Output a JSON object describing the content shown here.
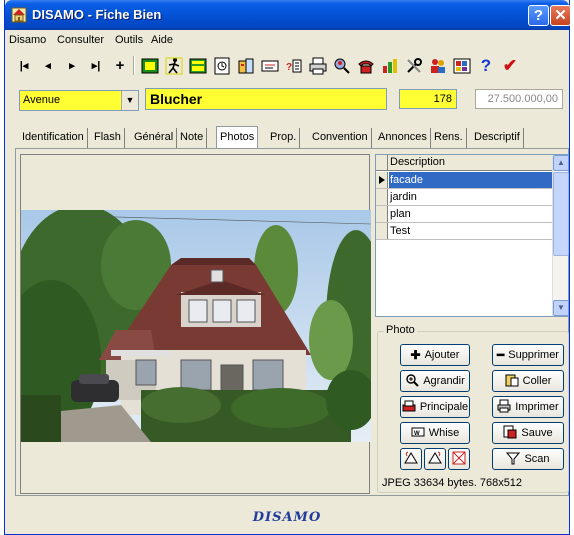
{
  "window": {
    "title": "DISAMO - Fiche Bien",
    "help_label": "?",
    "close_label": "✕"
  },
  "menu": [
    "Disamo",
    "Consulter",
    "Outils",
    "Aide"
  ],
  "toolbar": {
    "buttons": [
      "|◂",
      "◂",
      "▸",
      "▸|",
      "+"
    ]
  },
  "address": {
    "street_type": "Avenue",
    "street_name": "Blucher",
    "number": "178",
    "price": "27.500.000,00"
  },
  "tabs": [
    "Identification",
    "Flash",
    "Général",
    "Note",
    "Photos",
    "Prop.",
    "Convention",
    "Annonces",
    "Rens.",
    "Descriptif"
  ],
  "active_tab": "Photos",
  "photos_grid": {
    "header": "Description",
    "rows": [
      "facade",
      "jardin",
      "plan",
      "Test"
    ],
    "selected_index": 0
  },
  "photo_group": {
    "label": "Photo",
    "buttons": {
      "add": "Ajouter",
      "delete": "Supprimer",
      "enlarge": "Agrandir",
      "paste": "Coller",
      "main": "Principale",
      "print": "Imprimer",
      "whise": "Whise",
      "save": "Sauve",
      "scan": "Scan"
    },
    "file_info": "JPEG 33634 bytes. 768x512"
  },
  "status": {
    "text": "DISAMO"
  },
  "colors": {
    "title_bar": "#0352d4",
    "highlight_field": "#ffff33",
    "selection": "#316ac5",
    "status_text": "#1f3b9c"
  }
}
